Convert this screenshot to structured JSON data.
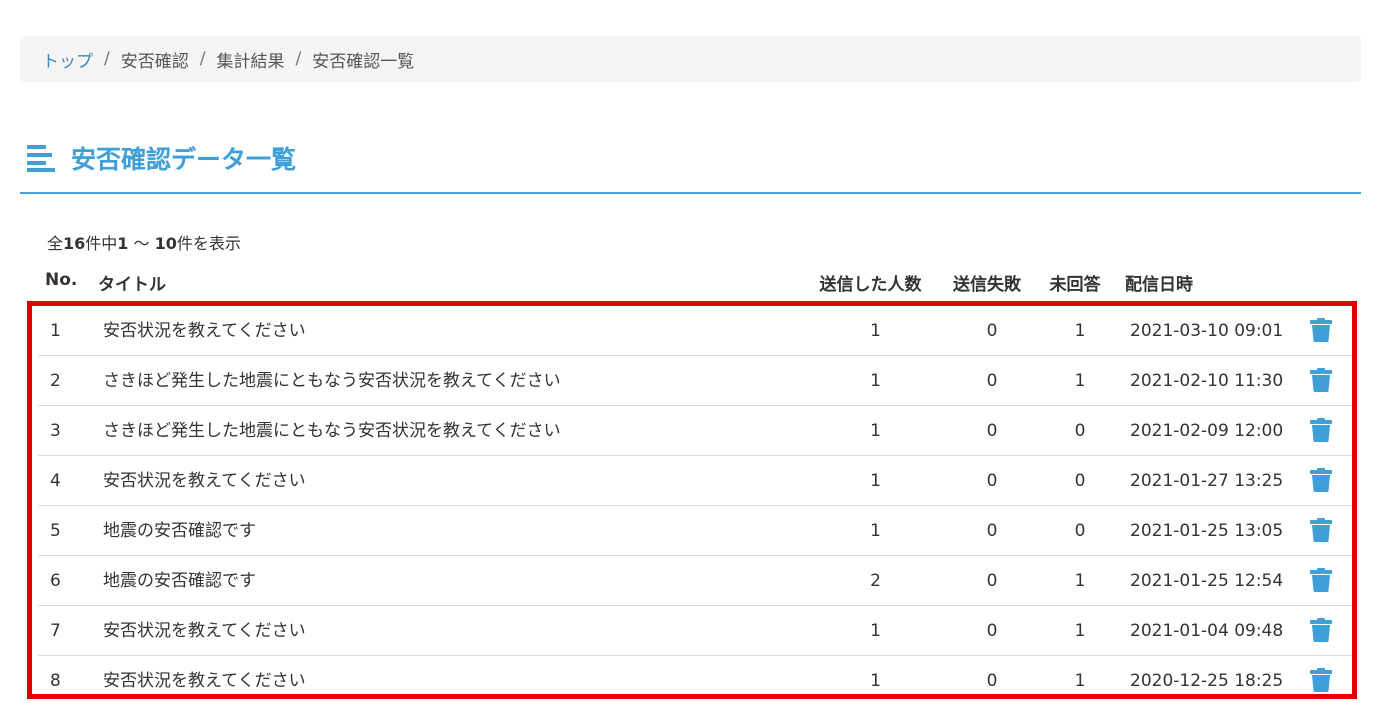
{
  "breadcrumb": {
    "items": [
      "トップ",
      "安否確認",
      "集計結果",
      "安否確認一覧"
    ],
    "separator": "/"
  },
  "page": {
    "title": "安否確認データ一覧",
    "accent_color": "#3f9fd8",
    "icon": "list-icon"
  },
  "summary": {
    "prefix": "全",
    "total": "16",
    "mid": "件中",
    "from": "1",
    "range_sep": " ～ ",
    "to": "10",
    "suffix": "件を表示"
  },
  "table": {
    "headers": {
      "no": "No.",
      "title": "タイトル",
      "sent": "送信した人数",
      "failed": "送信失敗",
      "unanswered": "未回答",
      "date": "配信日時"
    },
    "delete_icon": "trash-icon",
    "highlight_color": "#e00000",
    "rows": [
      {
        "no": "1",
        "title": "安否状況を教えてください",
        "sent": "1",
        "failed": "0",
        "unanswered": "1",
        "date": "2021-03-10 09:01"
      },
      {
        "no": "2",
        "title": "さきほど発生した地震にともなう安否状況を教えてください",
        "sent": "1",
        "failed": "0",
        "unanswered": "1",
        "date": "2021-02-10 11:30"
      },
      {
        "no": "3",
        "title": "さきほど発生した地震にともなう安否状況を教えてください",
        "sent": "1",
        "failed": "0",
        "unanswered": "0",
        "date": "2021-02-09 12:00"
      },
      {
        "no": "4",
        "title": "安否状況を教えてください",
        "sent": "1",
        "failed": "0",
        "unanswered": "0",
        "date": "2021-01-27 13:25"
      },
      {
        "no": "5",
        "title": "地震の安否確認です",
        "sent": "1",
        "failed": "0",
        "unanswered": "0",
        "date": "2021-01-25 13:05"
      },
      {
        "no": "6",
        "title": "地震の安否確認です",
        "sent": "2",
        "failed": "0",
        "unanswered": "1",
        "date": "2021-01-25 12:54"
      },
      {
        "no": "7",
        "title": "安否状況を教えてください",
        "sent": "1",
        "failed": "0",
        "unanswered": "1",
        "date": "2021-01-04 09:48"
      },
      {
        "no": "8",
        "title": "安否状況を教えてください",
        "sent": "1",
        "failed": "0",
        "unanswered": "1",
        "date": "2020-12-25 18:25"
      }
    ]
  }
}
